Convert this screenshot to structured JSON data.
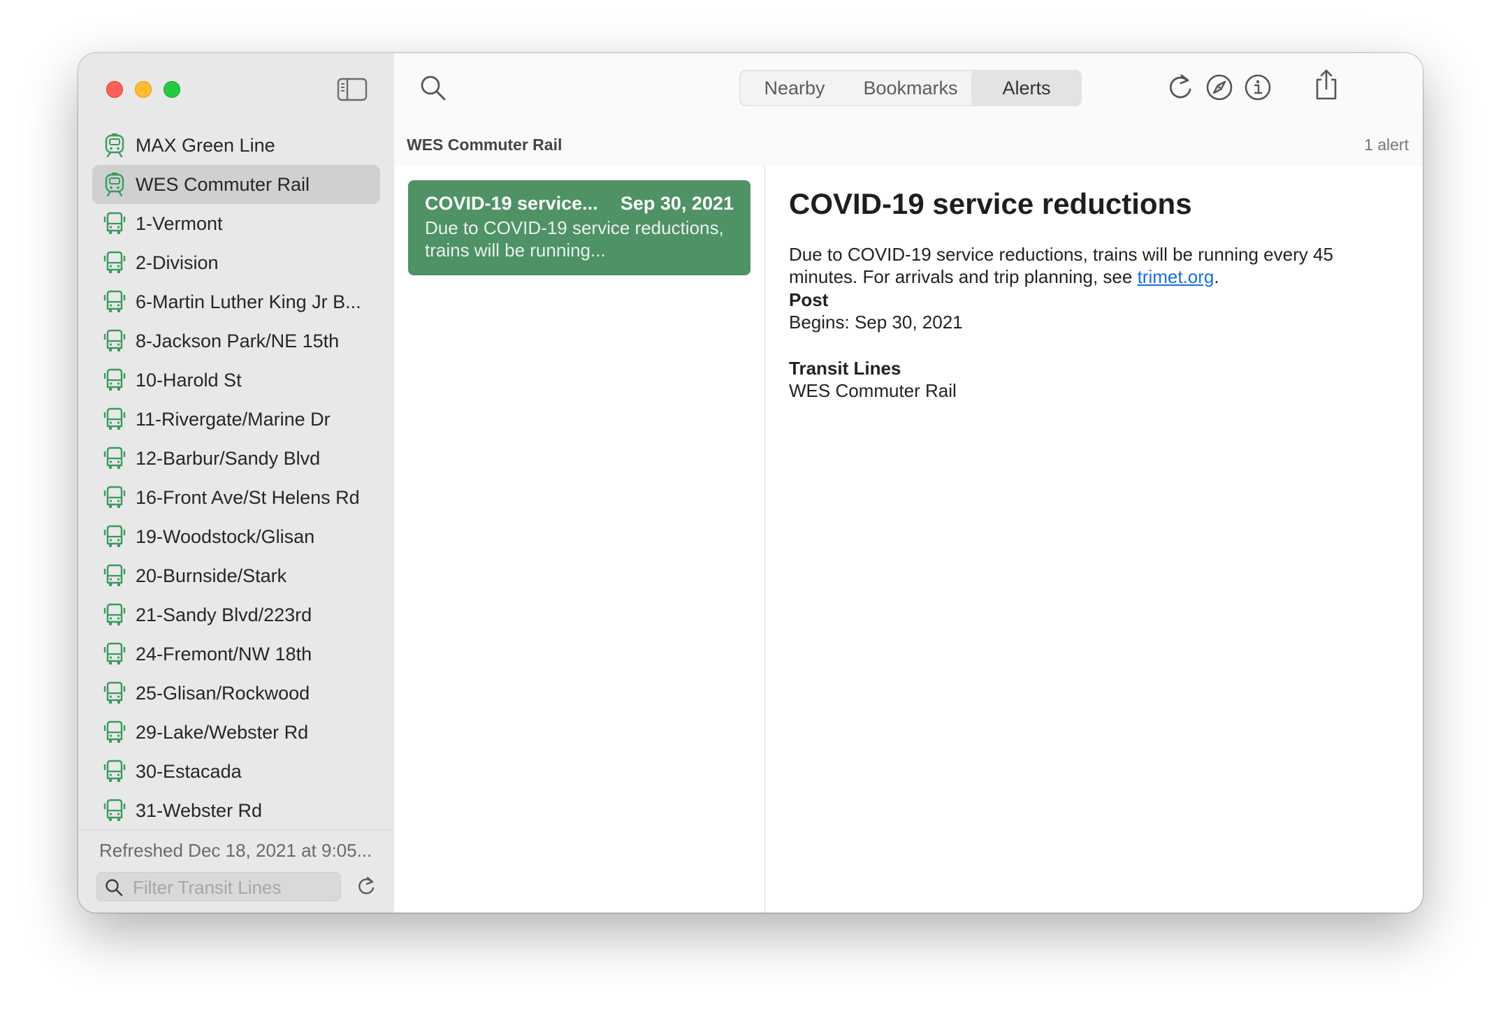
{
  "sidebar": {
    "lines": [
      {
        "label": "MAX Green Line",
        "icon": "tram-icon",
        "selected": false
      },
      {
        "label": "WES Commuter Rail",
        "icon": "tram-icon",
        "selected": true
      },
      {
        "label": "1-Vermont",
        "icon": "bus-icon",
        "selected": false
      },
      {
        "label": "2-Division",
        "icon": "bus-icon",
        "selected": false
      },
      {
        "label": "6-Martin Luther King Jr B...",
        "icon": "bus-icon",
        "selected": false
      },
      {
        "label": "8-Jackson Park/NE 15th",
        "icon": "bus-icon",
        "selected": false
      },
      {
        "label": "10-Harold St",
        "icon": "bus-icon",
        "selected": false
      },
      {
        "label": "11-Rivergate/Marine Dr",
        "icon": "bus-icon",
        "selected": false
      },
      {
        "label": "12-Barbur/Sandy Blvd",
        "icon": "bus-icon",
        "selected": false
      },
      {
        "label": "16-Front Ave/St Helens Rd",
        "icon": "bus-icon",
        "selected": false
      },
      {
        "label": "19-Woodstock/Glisan",
        "icon": "bus-icon",
        "selected": false
      },
      {
        "label": "20-Burnside/Stark",
        "icon": "bus-icon",
        "selected": false
      },
      {
        "label": "21-Sandy Blvd/223rd",
        "icon": "bus-icon",
        "selected": false
      },
      {
        "label": "24-Fremont/NW 18th",
        "icon": "bus-icon",
        "selected": false
      },
      {
        "label": "25-Glisan/Rockwood",
        "icon": "bus-icon",
        "selected": false
      },
      {
        "label": "29-Lake/Webster Rd",
        "icon": "bus-icon",
        "selected": false
      },
      {
        "label": "30-Estacada",
        "icon": "bus-icon",
        "selected": false
      },
      {
        "label": "31-Webster Rd",
        "icon": "bus-icon",
        "selected": false
      }
    ],
    "footer": {
      "refreshed": "Refreshed Dec 18, 2021 at 9:05...",
      "filter_placeholder": "Filter Transit Lines"
    }
  },
  "toolbar": {
    "tabs": [
      "Nearby",
      "Bookmarks",
      "Alerts"
    ],
    "active_tab": "Alerts"
  },
  "list_header": {
    "title": "WES Commuter Rail",
    "count": "1 alert"
  },
  "alerts": [
    {
      "title": "COVID-19 service...",
      "date": "Sep 30, 2021",
      "preview": "Due to COVID-19 service reductions, trains will be running..."
    }
  ],
  "detail": {
    "title": "COVID-19 service reductions",
    "body_prefix": "Due to COVID-19 service reductions, trains will be running every 45 minutes. For arrivals and trip planning, see ",
    "link_text": "trimet.org",
    "body_suffix": ".",
    "post_heading": "Post",
    "post_value": "Begins: Sep 30, 2021",
    "lines_heading": "Transit Lines",
    "lines_value": "WES Commuter Rail"
  },
  "colors": {
    "accent_green": "#4e9266",
    "icon_green": "#3a9a5c",
    "link_blue": "#1a6ed8"
  }
}
